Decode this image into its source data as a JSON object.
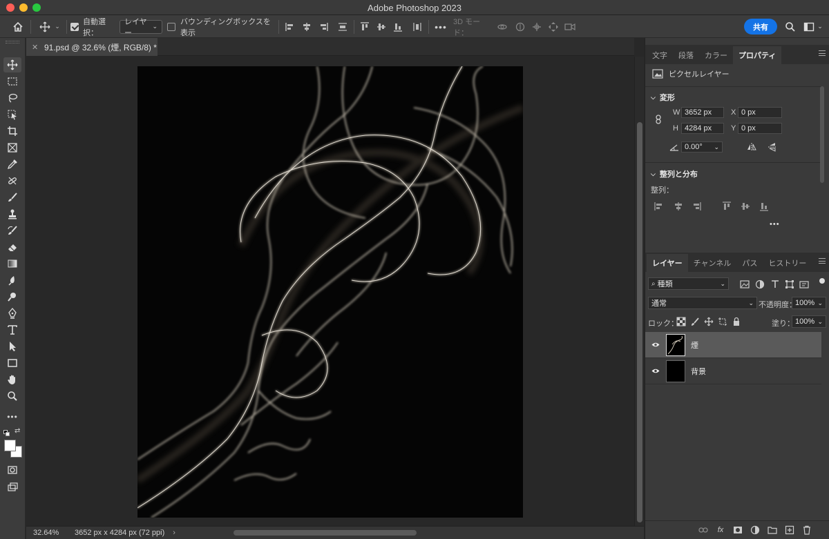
{
  "window": {
    "title": "Adobe Photoshop 2023"
  },
  "optionsbar": {
    "auto_select_label": "自動選択：",
    "auto_select_target": "レイヤー",
    "bbox_label": "バウンディングボックスを表示",
    "mode3d_label": "3D モード：",
    "share_label": "共有"
  },
  "document": {
    "tab_title": "91.psd @ 32.6% (煙, RGB/8) *",
    "zoom": "32.64%",
    "info": "3652 px x 4284 px (72 ppi)"
  },
  "properties_panel": {
    "tabs": [
      "文字",
      "段落",
      "カラー",
      "プロパティ"
    ],
    "active_tab": "プロパティ",
    "layer_kind": "ピクセルレイヤー",
    "transform": {
      "heading": "変形",
      "w_label": "W",
      "w_value": "3652 px",
      "h_label": "H",
      "h_value": "4284 px",
      "x_label": "X",
      "x_value": "0 px",
      "y_label": "Y",
      "y_value": "0 px",
      "angle_value": "0.00°"
    },
    "align": {
      "heading": "整列と分布",
      "sub_label": "整列：",
      "more": "•••"
    }
  },
  "layers_panel": {
    "tabs": [
      "レイヤー",
      "チャンネル",
      "パス",
      "ヒストリー"
    ],
    "active_tab": "レイヤー",
    "filter_label": "種類",
    "blend_mode": "通常",
    "opacity_label": "不透明度：",
    "opacity_value": "100%",
    "lock_label": "ロック：",
    "fill_label": "塗り：",
    "fill_value": "100%",
    "layers": [
      {
        "name": "煙",
        "selected": true
      },
      {
        "name": "背景",
        "selected": false
      }
    ]
  },
  "colors": {
    "share_button": "#1473e6",
    "canvas_bg": "#050505",
    "smoke": "#d9d0c0"
  }
}
